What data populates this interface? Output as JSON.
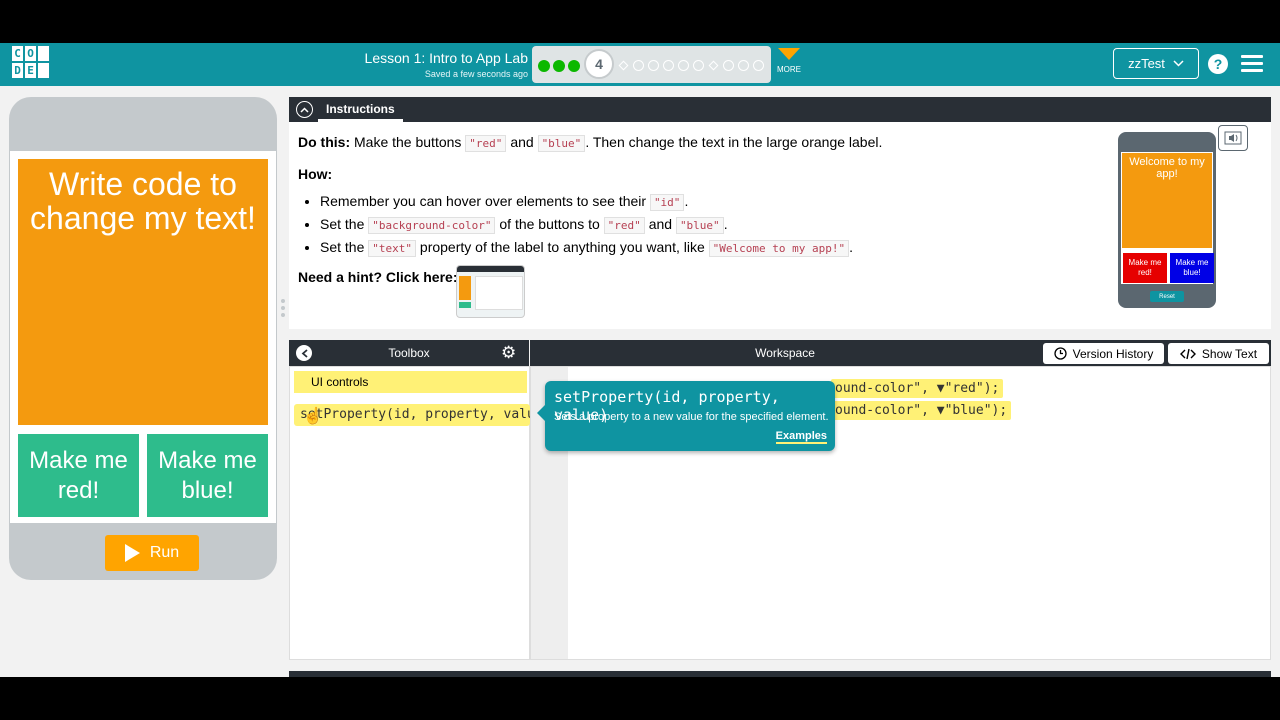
{
  "header": {
    "logo_letters": [
      "C",
      "O",
      "",
      "D",
      "E",
      ""
    ],
    "lesson_title": "Lesson 1: Intro to App Lab",
    "saved_status": "Saved a few seconds ago",
    "current_level": "4",
    "more_label": "MORE",
    "user_name": "zzTest",
    "help_label": "?"
  },
  "app_preview": {
    "big_label_text": "Write code to change my text!",
    "button_red_text": "Make me red!",
    "button_blue_text": "Make me blue!",
    "run_label": "Run",
    "label_color": "#f49a0f",
    "button_color": "#2ebc8c"
  },
  "instructions": {
    "tab_label": "Instructions",
    "do_this_label": "Do this:",
    "do_this_text_1": "Make the buttons",
    "code_red": "\"red\"",
    "and": "and",
    "code_blue": "\"blue\"",
    "do_this_text_2": ". Then change the text in the large orange label.",
    "how_label": "How:",
    "bullet1_text": "Remember you can hover over elements to see their",
    "bullet1_code": "\"id\"",
    "bullet2_text_a": "Set the",
    "bullet2_code_a": "\"background-color\"",
    "bullet2_text_b": "of the buttons to",
    "bullet3_text_a": "Set the",
    "bullet3_code_a": "\"text\"",
    "bullet3_text_b": "property of the label to anything you want, like",
    "bullet3_code_b": "\"Welcome to my app!\"",
    "period": ".",
    "hint_label": "Need a hint? Click here:",
    "example_label_text": "Welcome to my app!",
    "example_red_text": "Make me red!",
    "example_blue_text": "Make me blue!",
    "example_reset": "Reset"
  },
  "toolbox": {
    "title": "Toolbox",
    "category": "UI controls",
    "block_text": "setProperty(id, property, value)"
  },
  "workspace": {
    "title": "Workspace",
    "version_history_label": "Version History",
    "show_text_label": "Show Text",
    "line1_visible": "ound-color\", ▼\"red\");",
    "line2_visible": "ound-color\", ▼\"blue\");"
  },
  "tooltip": {
    "signature": "setProperty(id, property, value)",
    "description": "Sets a property to a new value for the specified element.",
    "examples_link": "Examples"
  }
}
